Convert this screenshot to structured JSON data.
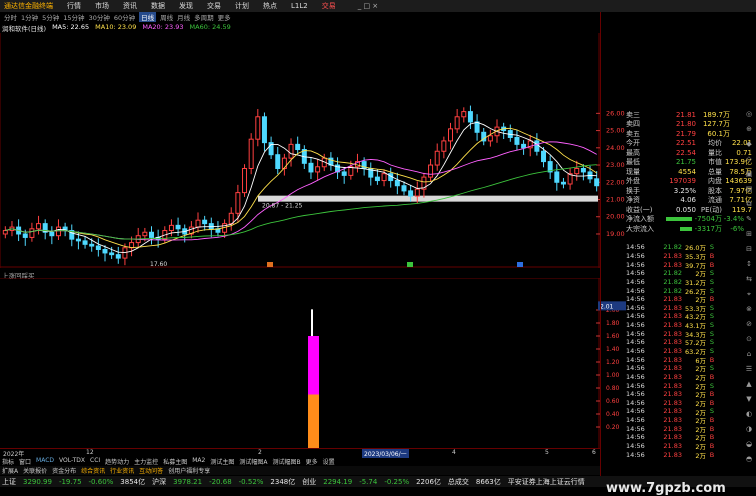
{
  "titlebar": {
    "logo": "通达信金融终端",
    "menu": [
      "行情",
      "市场",
      "资讯",
      "数据",
      "发现",
      "交易",
      "计划",
      "热点",
      "L1L2"
    ],
    "warning": "交易",
    "window_buttons": "_ □ ×"
  },
  "timeframes": {
    "items": [
      "分时",
      "1分钟",
      "5分钟",
      "15分钟",
      "30分钟",
      "60分钟",
      "日线",
      "周线",
      "月线",
      "多周期",
      "更多"
    ],
    "selected": "日线"
  },
  "ma_legend": {
    "name": "润和软件(日线)",
    "items": [
      {
        "label": "MA5: 22.65",
        "color": "#ffffff"
      },
      {
        "label": "MA10: 23.09",
        "color": "#ffe14b"
      },
      {
        "label": "MA20: 23.93",
        "color": "#ff60ff"
      },
      {
        "label": "MA60: 24.59",
        "color": "#3cc43c"
      }
    ]
  },
  "price_axis": [
    "26.00",
    "25.00",
    "24.00",
    "23.00",
    "22.00",
    "21.00",
    "20.00",
    "19.00"
  ],
  "annotations": {
    "low": "17.60",
    "range": "20.87 - 21.25"
  },
  "sub": {
    "title": "上涨回踩买",
    "axis_top": "2.01",
    "axis": [
      "2.00",
      "1.80",
      "1.60",
      "1.40",
      "1.20",
      "1.00",
      "0.80",
      "0.60",
      "0.40",
      "0.20"
    ]
  },
  "datebar": {
    "year": "2022年",
    "m12": "12",
    "m2": "2",
    "date_sel": "2023/03/06/一",
    "m4": "4",
    "m5": "5",
    "m6": "6"
  },
  "ind_tabs": [
    "指标",
    "窗口",
    "MACD",
    "VOL-TDX",
    "CCI",
    "趋势动力",
    "主力监控",
    "私募主图",
    "MA2",
    "测试主图",
    "测试幅图A",
    "测试幅图B",
    "更多",
    "设置"
  ],
  "bottom_tabs": [
    "扩展A",
    "关联报价",
    "资金分布",
    "综合资讯",
    "行业资讯",
    "互动问答",
    "创用户福利专享"
  ],
  "quotes": [
    {
      "k": "卖三",
      "v": "21.81",
      "n": "189.7万",
      "vc": "#ff4040"
    },
    {
      "k": "卖四",
      "v": "21.80",
      "n": "127.7万",
      "vc": "#ff4040"
    },
    {
      "k": "卖五",
      "v": "21.79",
      "n": "60.1万",
      "vc": "#ff4040"
    },
    {
      "k": "今开",
      "v": "22.51",
      "n": "均价",
      "n2": "22.01",
      "vc": "#ff4040"
    },
    {
      "k": "最高",
      "v": "22.54",
      "n": "量比",
      "n2": "0.71",
      "vc": "#ff4040"
    },
    {
      "k": "最低",
      "v": "21.75",
      "n": "市值",
      "n2": "173.9亿",
      "vc": "#3cc43c"
    },
    {
      "k": "现量",
      "v": "4554",
      "n": "总量",
      "n2": "78.5万",
      "vc": "#ffe14b"
    },
    {
      "k": "外盘",
      "v": "197039",
      "n": "内盘",
      "n2": "143639",
      "vc": "#ff4040"
    },
    {
      "k": "换手",
      "v": "3.25%",
      "n": "股本",
      "n2": "7.97亿",
      "vc": "#e6e6e6"
    },
    {
      "k": "净资",
      "v": "4.06",
      "n": "流通",
      "n2": "7.71亿",
      "vc": "#e6e6e6"
    },
    {
      "k": "收益(一)",
      "v": "0.050",
      "n": "PE(动)",
      "n2": "119.7",
      "vc": "#e6e6e6"
    }
  ],
  "flows": [
    {
      "k": "净流入额",
      "v": "-7504万",
      "p": "-3.4%"
    },
    {
      "k": "大宗流入",
      "v": "-3317万",
      "p": "-6%"
    }
  ],
  "ticks": [
    {
      "t": "14:56",
      "p": "21.82",
      "v": "26.0万",
      "d": "S"
    },
    {
      "t": "14:56",
      "p": "21.83",
      "v": "35.3万",
      "d": "B"
    },
    {
      "t": "14:56",
      "p": "21.83",
      "v": "39.7万",
      "d": "B"
    },
    {
      "t": "14:56",
      "p": "21.82",
      "v": "2万",
      "d": "S"
    },
    {
      "t": "14:56",
      "p": "21.82",
      "v": "31.2万",
      "d": "S"
    },
    {
      "t": "14:56",
      "p": "21.82",
      "v": "26.2万",
      "d": "S"
    },
    {
      "t": "14:56",
      "p": "21.83",
      "v": "2万",
      "d": "B"
    },
    {
      "t": "14:56",
      "p": "21.83",
      "v": "53.3万",
      "d": "S"
    },
    {
      "t": "14:56",
      "p": "21.83",
      "v": "43.2万",
      "d": "S"
    },
    {
      "t": "14:56",
      "p": "21.83",
      "v": "43.1万",
      "d": "S"
    },
    {
      "t": "14:56",
      "p": "21.83",
      "v": "34.3万",
      "d": "S"
    },
    {
      "t": "14:56",
      "p": "21.83",
      "v": "57.2万",
      "d": "S"
    },
    {
      "t": "14:56",
      "p": "21.83",
      "v": "63.2万",
      "d": "S"
    },
    {
      "t": "14:56",
      "p": "21.83",
      "v": "6万",
      "d": "B"
    },
    {
      "t": "14:56",
      "p": "21.83",
      "v": "2万",
      "d": "S"
    },
    {
      "t": "14:56",
      "p": "21.83",
      "v": "2万",
      "d": "B"
    },
    {
      "t": "14:56",
      "p": "21.83",
      "v": "2万",
      "d": "S"
    },
    {
      "t": "14:56",
      "p": "21.83",
      "v": "2万",
      "d": "B"
    },
    {
      "t": "14:56",
      "p": "21.83",
      "v": "2万",
      "d": "B"
    },
    {
      "t": "14:56",
      "p": "21.83",
      "v": "2万",
      "d": "S"
    },
    {
      "t": "14:56",
      "p": "21.83",
      "v": "2万",
      "d": "B"
    },
    {
      "t": "14:56",
      "p": "21.83",
      "v": "2万",
      "d": "B"
    },
    {
      "t": "14:56",
      "p": "21.83",
      "v": "2万",
      "d": "B"
    },
    {
      "t": "14:56",
      "p": "21.83",
      "v": "2万",
      "d": "B"
    },
    {
      "t": "14:56",
      "p": "21.83",
      "v": "2万",
      "d": "B"
    }
  ],
  "statusbar": {
    "sh_label": "上证",
    "sh_val": "3290.99",
    "sh_chg": "-19.75",
    "sh_pct": "-0.60%",
    "sh_amt": "3854亿",
    "sz_label": "沪深",
    "sz_val": "3978.21",
    "sz_chg": "-20.68",
    "sz_pct": "-0.52%",
    "sz_amt": "2348亿",
    "cy_label": "创业",
    "cy_val": "2294.19",
    "cy_chg": "-5.74",
    "cy_pct": "-0.25%",
    "cy_amt": "2206亿",
    "total_label": "总成交",
    "total_val": "8663亿",
    "broker": "平安证券上海上证云行情"
  },
  "watermark": "www.7gpzb.com",
  "tools": [
    "◎",
    "⊕",
    "◆",
    "◇",
    "▣",
    "▤",
    "⧉",
    "✎",
    "⊞",
    "⊟",
    "↕",
    "⇆",
    "⌖",
    "⊗",
    "⊘",
    "⊙",
    "⌂",
    "☰",
    "▲",
    "▼",
    "◐",
    "◑",
    "◒",
    "◓"
  ],
  "colors": {
    "up": "#ff4040",
    "down": "#4fd9ff",
    "ma5": "#ffffff",
    "ma10": "#ffe14b",
    "ma20": "#ff60ff",
    "ma60": "#3cc43c",
    "orange": "#ff8c1a",
    "magenta": "#ff00ff"
  }
}
